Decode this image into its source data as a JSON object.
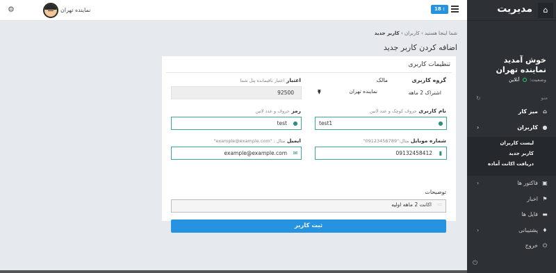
{
  "topbar": {
    "user_name": "نماینده تهران",
    "clock": "18 : 53"
  },
  "sidebar": {
    "brand": "مدیریت",
    "welcome": "خوش آمدید",
    "user_title": "نماینده تهران",
    "status_label": "وضعیت:",
    "status_value": "آنلاین",
    "menu_label": "منو",
    "items": [
      {
        "label": "میز کار",
        "icon": "home-icon"
      },
      {
        "label": "کاربران",
        "icon": "user-icon"
      },
      {
        "label": "فاکتور ها",
        "icon": "invoice-icon"
      },
      {
        "label": "اخبار",
        "icon": "flag-icon"
      },
      {
        "label": "فایل ها",
        "icon": "folder-icon"
      },
      {
        "label": "پشتیبانی",
        "icon": "bulb-icon"
      },
      {
        "label": "خروج",
        "icon": "power-icon"
      }
    ],
    "sub_items": [
      "لیست کاربران",
      "کاربر جدید",
      "دریافت اکانت آماده"
    ]
  },
  "breadcrumb": {
    "root": "شما اینجا هستید",
    "parent": "کاربران",
    "current": "کاربر جدید"
  },
  "page_title": "اضافه کردن کاربر جدید",
  "form": {
    "section_title": "تنظیمات کاربری",
    "group_label": "گروه کاربری",
    "group_value": "اشتراک 2 ماهه",
    "owner_label": "مالک",
    "owner_value": "نماینده تهران",
    "credit_label": "اعتبار",
    "credit_hint": "اعتبار باقیمانده پنل شما",
    "credit_value": "92500",
    "username_label": "نام کاربری",
    "username_hint": "حروف کوچک و عدد لاتین",
    "username_value": "test1",
    "password_label": "رمز",
    "password_hint": "حروف و عدد لاتین",
    "password_value": "test",
    "mobile_label": "شماره موبایل",
    "mobile_hint": "مثال:\"09123456789\"",
    "mobile_value": "09132458412",
    "email_label": "ایمیل",
    "email_hint": "مثال : \"example@example.com\"",
    "email_value": "example@example.com",
    "desc_label": "توضیحات",
    "desc_value": "اکانت 2 ماهه اولیه",
    "submit_label": "ثبت کاربر"
  }
}
